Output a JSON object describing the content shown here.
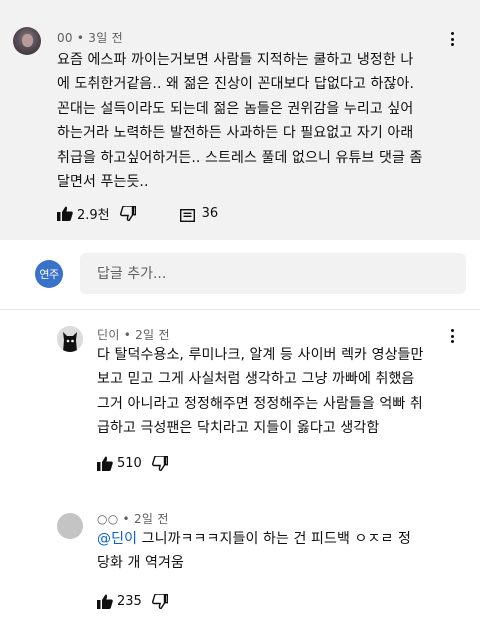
{
  "main_comment": {
    "author": "00",
    "time": "3일 전",
    "text": "요즘 에스파 까이는거보면 사람들 지적하는 쿨하고 냉정한 나\n에 도취한거같음.. 왜 젊은 진상이 꼰대보다 답없다고 하잖아.\n꼰대는 설득이라도 되는데 젊은 놈들은 권위감을 누리고 싶어\n하는거라 노력하든 발전하든 사과하든 다 필요없고 자기 아래\n취급을 하고싶어하거든.. 스트레스 풀데 없으니 유튜브 댓글 좀\n달면서 푸는듯..",
    "likes": "2.9천",
    "replies": "36"
  },
  "reply_box": {
    "avatar_text": "연주",
    "placeholder": "답글 추가..."
  },
  "replies": [
    {
      "author": "딘이",
      "time": "2일 전",
      "text": "다 탈덕수용소, 루미나크, 알계 등 사이버 렉카 영상들만\n보고 믿고 그게 사실처럼 생각하고 그냥 까빠에 취했음\n그거 아니라고 정정해주면 정정해주는 사람들을 억빠 취\n급하고 극성팬은 닥치라고 지들이 옳다고 생각함",
      "likes": "510"
    },
    {
      "author": "○○",
      "time": "2일 전",
      "mention": "@딘이",
      "text_line1": "  그니까ㅋㅋㅋ지들이 하는 건 피드백 ㅇㅈㄹ 정",
      "text_line2": "당화 개 역겨움",
      "likes": "235"
    }
  ],
  "icons": {
    "like": "thumbs-up-icon",
    "dislike": "thumbs-down-icon",
    "reply": "reply-comment-icon",
    "more": "more-vert-icon"
  },
  "colors": {
    "main_bg": "#f2f2f2",
    "text": "#0f0f0f",
    "meta": "#606060",
    "mention": "#065fd4",
    "me_avatar": "#3a72c9"
  }
}
